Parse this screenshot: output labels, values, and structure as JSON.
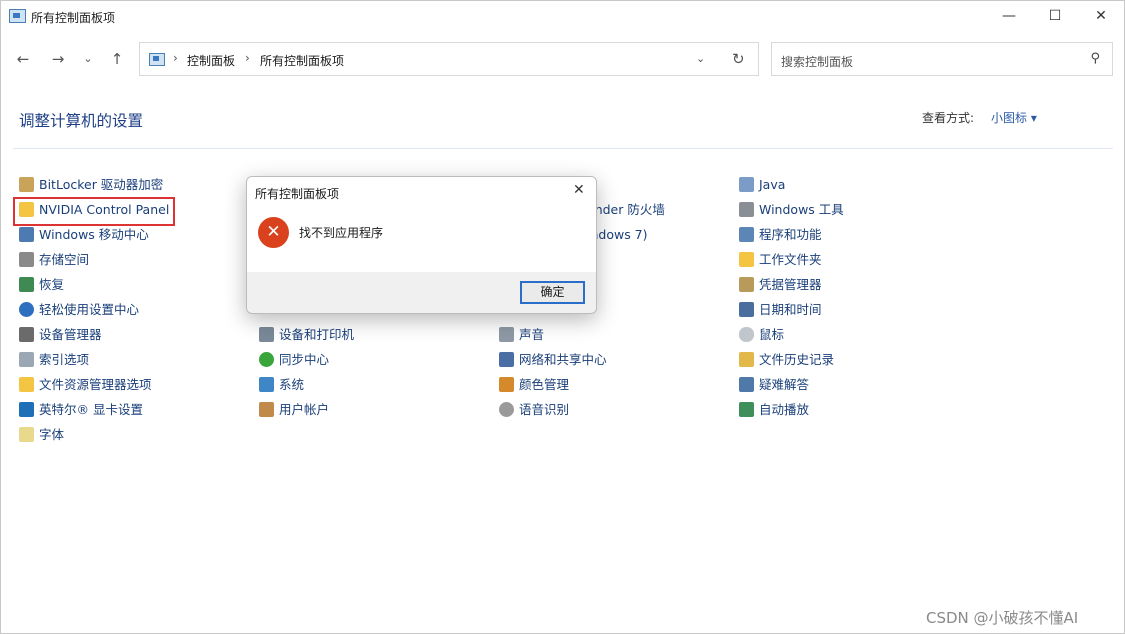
{
  "window": {
    "title": "所有控制面板项"
  },
  "window_controls": {
    "minimize": "—",
    "maximize": "☐",
    "close": "✕"
  },
  "nav": {
    "back": "←",
    "forward": "→",
    "recent": "⌄",
    "up": "↑",
    "sep": "›",
    "dropdown": "⌄",
    "refresh": "↻"
  },
  "breadcrumb": {
    "item1": "控制面板",
    "item2": "所有控制面板项"
  },
  "search": {
    "placeholder": "搜索控制面板",
    "icon": "⚲"
  },
  "heading": "调整计算机的设置",
  "view": {
    "label": "查看方式:",
    "value": "小图标 ▾"
  },
  "items": {
    "col1": [
      "BitLocker 驱动器加密",
      "NVIDIA Control Panel",
      "Windows 移动中心",
      "存储空间",
      "恢复",
      "轻松使用设置中心",
      "设备管理器",
      "索引选项",
      "文件资源管理器选项",
      "英特尔® 显卡设置",
      "字体"
    ],
    "col2": [
      "设备和打印机",
      "同步中心",
      "系统",
      "用户帐户"
    ],
    "col3": [
      "ender 防火墙",
      "indows 7)",
      "声音",
      "网络和共享中心",
      "颜色管理",
      "语音识别"
    ],
    "col4": [
      "Java",
      "Windows 工具",
      "程序和功能",
      "工作文件夹",
      "凭据管理器",
      "日期和时间",
      "鼠标",
      "文件历史记录",
      "疑难解答",
      "自动播放"
    ]
  },
  "dialog": {
    "title": "所有控制面板项",
    "close": "✕",
    "error_glyph": "✕",
    "message": "找不到应用程序",
    "ok": "确定"
  },
  "watermark": "CSDN @小破孩不懂AI"
}
